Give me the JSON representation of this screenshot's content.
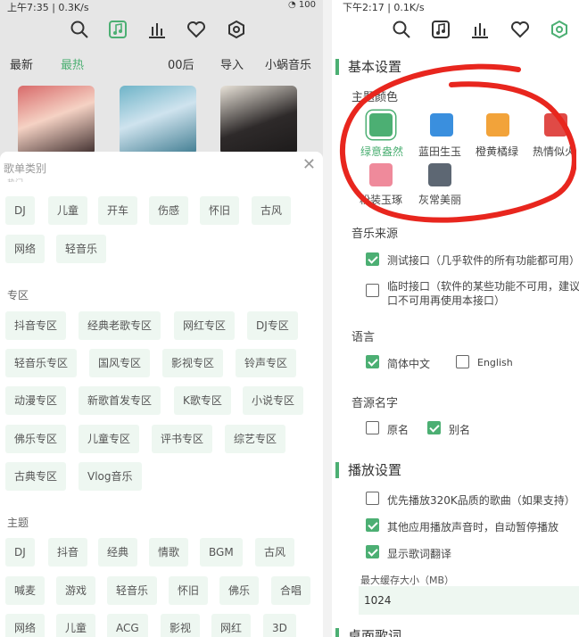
{
  "left": {
    "status": {
      "time": "上午7:35",
      "net": "0.3K/s",
      "right": "100"
    },
    "nav_icons": [
      "search-icon",
      "music-icon",
      "chart-icon",
      "heart-icon",
      "settings-icon"
    ],
    "tabs": [
      "最新",
      "最热",
      "00后",
      "导入",
      "小蜗音乐"
    ],
    "active_tab": "最热",
    "sheet": {
      "title": "歌单类别",
      "partial_header": "热门",
      "row1": [
        "DJ",
        "儿童",
        "开车",
        "伤感",
        "怀旧",
        "古风"
      ],
      "row2": [
        "网络",
        "轻音乐"
      ],
      "zone_label": "专区",
      "zone_rows": [
        [
          "抖音专区",
          "经典老歌专区",
          "网红专区",
          "DJ专区"
        ],
        [
          "轻音乐专区",
          "国风专区",
          "影视专区",
          "铃声专区"
        ],
        [
          "动漫专区",
          "新歌首发专区",
          "K歌专区",
          "小说专区"
        ],
        [
          "佛乐专区",
          "儿童专区",
          "评书专区",
          "综艺专区"
        ],
        [
          "古典专区",
          "Vlog音乐"
        ]
      ],
      "theme_label": "主题",
      "theme_rows": [
        [
          "DJ",
          "抖音",
          "经典",
          "情歌",
          "BGM",
          "古风"
        ],
        [
          "喊麦",
          "游戏",
          "轻音乐",
          "怀旧",
          "佛乐",
          "合唱"
        ],
        [
          "网络",
          "儿童",
          "ACG",
          "影视",
          "网红",
          "3D"
        ]
      ]
    }
  },
  "right": {
    "status": {
      "time": "下午2:17",
      "net": "0.1K/s"
    },
    "basic_title": "基本设置",
    "theme_color_label": "主题颜色",
    "colors": [
      {
        "name": "绿意盎然",
        "color": "#4caf73",
        "selected": true
      },
      {
        "name": "蓝田生玉",
        "color": "#3a8fde",
        "selected": false
      },
      {
        "name": "橙黄橘绿",
        "color": "#f2a33a",
        "selected": false
      },
      {
        "name": "热情似火",
        "color": "#e04a46",
        "selected": false
      },
      {
        "name": "粉装玉琢",
        "color": "#ef8a9b",
        "selected": false
      },
      {
        "name": "灰常美丽",
        "color": "#5d6773",
        "selected": false
      }
    ],
    "source_label": "音乐来源",
    "source_opt1": "测试接口（几乎软件的所有功能都可用）",
    "source_opt2_l1": "临时接口（软件的某些功能不可用，建议",
    "source_opt2_l2": "口不可用再使用本接口）",
    "lang_label": "语言",
    "lang_zh": "简体中文",
    "lang_en": "English",
    "srcname_label": "音源名字",
    "srcname_orig": "原名",
    "srcname_alias": "别名",
    "play_title": "播放设置",
    "play_opt1": "优先播放320K品质的歌曲（如果支持）",
    "play_opt2": "其他应用播放声音时，自动暂停播放",
    "play_opt3": "显示歌词翻译",
    "cache_label": "最大缓存大小（MB）",
    "cache_value": "1024",
    "next_title": "桌面歌词"
  }
}
